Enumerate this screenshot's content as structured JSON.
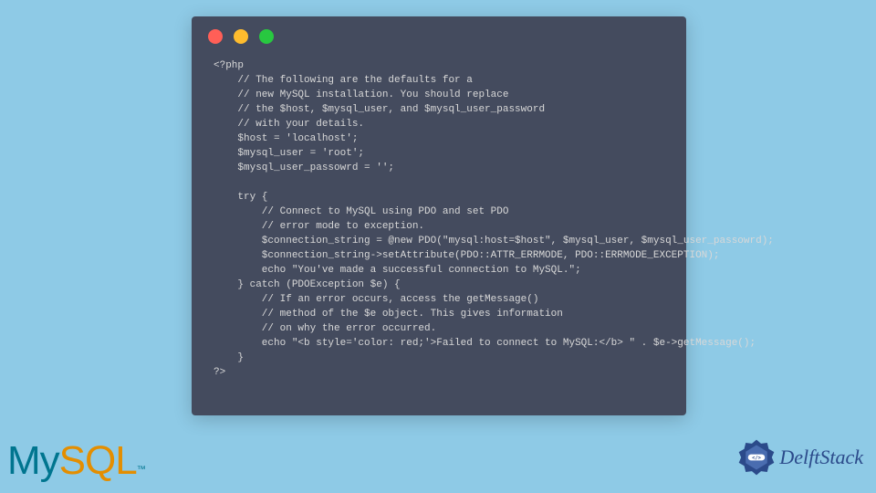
{
  "code": {
    "lines": [
      "<?php",
      "    // The following are the defaults for a",
      "    // new MySQL installation. You should replace",
      "    // the $host, $mysql_user, and $mysql_user_password",
      "    // with your details.",
      "    $host = 'localhost';",
      "    $mysql_user = 'root';",
      "    $mysql_user_passowrd = '';",
      "",
      "    try {",
      "        // Connect to MySQL using PDO and set PDO",
      "        // error mode to exception.",
      "        $connection_string = @new PDO(\"mysql:host=$host\", $mysql_user, $mysql_user_passowrd);",
      "        $connection_string->setAttribute(PDO::ATTR_ERRMODE, PDO::ERRMODE_EXCEPTION);",
      "        echo \"You've made a successful connection to MySQL.\";",
      "    } catch (PDOException $e) {",
      "        // If an error occurs, access the getMessage()",
      "        // method of the $e object. This gives information",
      "        // on why the error occurred.",
      "        echo \"<b style='color: red;'>Failed to connect to MySQL:</b> \" . $e->getMessage();",
      "    }",
      "?>"
    ]
  },
  "mysql": {
    "part1": "My",
    "part2": "SQL",
    "tm": "™"
  },
  "delft": {
    "text": "DelftStack"
  }
}
